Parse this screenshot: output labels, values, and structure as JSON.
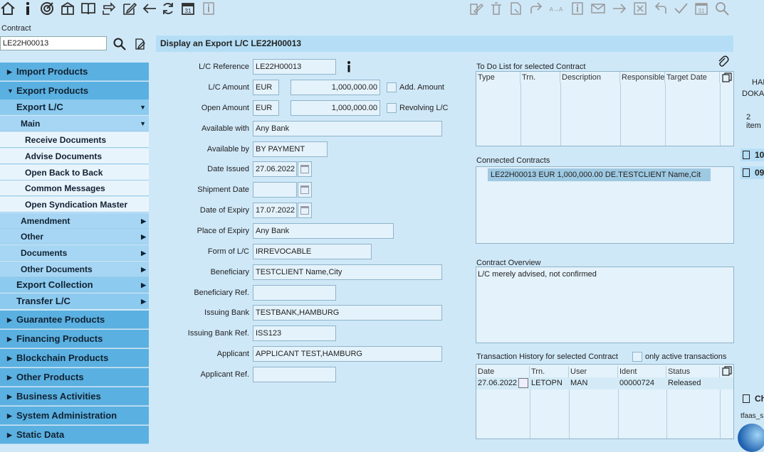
{
  "contract": {
    "label": "Contract",
    "value": "LE22H00013"
  },
  "nav": [
    {
      "label": "Import Products",
      "level": "l0",
      "marker": "▶"
    },
    {
      "label": "Export Products",
      "level": "l0",
      "marker": "▼"
    },
    {
      "label": "Export L/C",
      "level": "l1",
      "marker": "▼"
    },
    {
      "label": "Main",
      "level": "l2h",
      "marker": "▼"
    },
    {
      "label": "Receive Documents",
      "level": "l3"
    },
    {
      "label": "Advise Documents",
      "level": "l3"
    },
    {
      "label": "Open Back to Back",
      "level": "l3"
    },
    {
      "label": "Common Messages",
      "level": "l3"
    },
    {
      "label": "Open Syndication Master",
      "level": "l3"
    },
    {
      "label": "Amendment",
      "level": "l2",
      "marker": "▶"
    },
    {
      "label": "Other",
      "level": "l2",
      "marker": "▶"
    },
    {
      "label": "Documents",
      "level": "l2",
      "marker": "▶"
    },
    {
      "label": "Other Documents",
      "level": "l2",
      "marker": "▶"
    },
    {
      "label": "Export Collection",
      "level": "l1",
      "marker": "▶"
    },
    {
      "label": "Transfer L/C",
      "level": "l1",
      "marker": "▶"
    },
    {
      "label": "Guarantee Products",
      "level": "l0",
      "marker": "▶"
    },
    {
      "label": "Financing Products",
      "level": "l0",
      "marker": "▶"
    },
    {
      "label": "Blockchain Products",
      "level": "l0",
      "marker": "▶"
    },
    {
      "label": "Other Products",
      "level": "l0",
      "marker": "▶"
    },
    {
      "label": "Business Activities",
      "level": "l0",
      "marker": "▶"
    },
    {
      "label": "System Administration",
      "level": "l0",
      "marker": "▶"
    },
    {
      "label": "Static Data",
      "level": "l0",
      "marker": "▶"
    }
  ],
  "page_title": "Display an Export L/C LE22H00013",
  "form": {
    "lc_reference": {
      "label": "L/C Reference",
      "value": "LE22H00013"
    },
    "lc_amount": {
      "label": "L/C Amount",
      "currency": "EUR",
      "value": "1,000,000.00"
    },
    "add_amount": "Add. Amount",
    "open_amount": {
      "label": "Open Amount",
      "currency": "EUR",
      "value": "1,000,000.00"
    },
    "revolving": "Revolving L/C",
    "available_with": {
      "label": "Available with",
      "value": "Any Bank"
    },
    "available_by": {
      "label": "Available by",
      "value": "BY PAYMENT"
    },
    "date_issued": {
      "label": "Date Issued",
      "value": "27.06.2022"
    },
    "shipment_date": {
      "label": "Shipment Date",
      "value": ""
    },
    "date_of_expiry": {
      "label": "Date of Expiry",
      "value": "17.07.2022"
    },
    "place_of_expiry": {
      "label": "Place of Expiry",
      "value": "Any Bank"
    },
    "form_of_lc": {
      "label": "Form of L/C",
      "value": "IRREVOCABLE"
    },
    "beneficiary": {
      "label": "Beneficiary",
      "value": "TESTCLIENT Name,City"
    },
    "beneficiary_ref": {
      "label": "Beneficiary Ref.",
      "value": ""
    },
    "issuing_bank": {
      "label": "Issuing Bank",
      "value": "TESTBANK,HAMBURG"
    },
    "issuing_bank_ref": {
      "label": "Issuing Bank Ref.",
      "value": "ISS123"
    },
    "applicant": {
      "label": "Applicant",
      "value": "APPLICANT TEST,HAMBURG"
    },
    "applicant_ref": {
      "label": "Applicant Ref.",
      "value": ""
    }
  },
  "todo": {
    "title": "To Do List for selected Contract",
    "columns": [
      "Type",
      "Trn.",
      "Description",
      "Responsible",
      "Target Date"
    ]
  },
  "connected": {
    "title": "Connected Contracts",
    "row": "LE22H00013 EUR 1,000,000.00 DE.TESTCLIENT Name,Cit"
  },
  "overview": {
    "title": "Contract Overview",
    "text": "L/C merely advised, not confirmed"
  },
  "history": {
    "title": "Transaction History for selected Contract",
    "only_active": "only active transactions",
    "columns": [
      "Date",
      "Trn.",
      "User",
      "Ident",
      "Status"
    ],
    "rows": [
      [
        "27.06.2022",
        "LETOPN",
        "MAN",
        "00000724",
        "Released"
      ]
    ]
  },
  "right_edge": {
    "t1": "HAI",
    "t2": "DOKA",
    "items": "2 item",
    "doc1": "10",
    "doc2": "09",
    "ch": "Ch",
    "tfaas": "tfaas_s"
  },
  "toolbar_icons": [
    "home-icon",
    "info-icon",
    "target-icon",
    "gift-icon",
    "book-icon",
    "cycle-icon",
    "edit-icon",
    "back-arrow-icon",
    "refresh-icon",
    "calendar-icon",
    "info-small-icon"
  ],
  "toolbar_right_icons": [
    "edit-pen-icon",
    "trash-icon",
    "attach-doc-icon",
    "forward-icon",
    "swap-icon",
    "info-box-icon",
    "mail-icon",
    "arrow-right-icon",
    "cancel-box-icon",
    "undo-icon",
    "check-icon",
    "calendar-31-icon",
    "zoom-icon"
  ]
}
